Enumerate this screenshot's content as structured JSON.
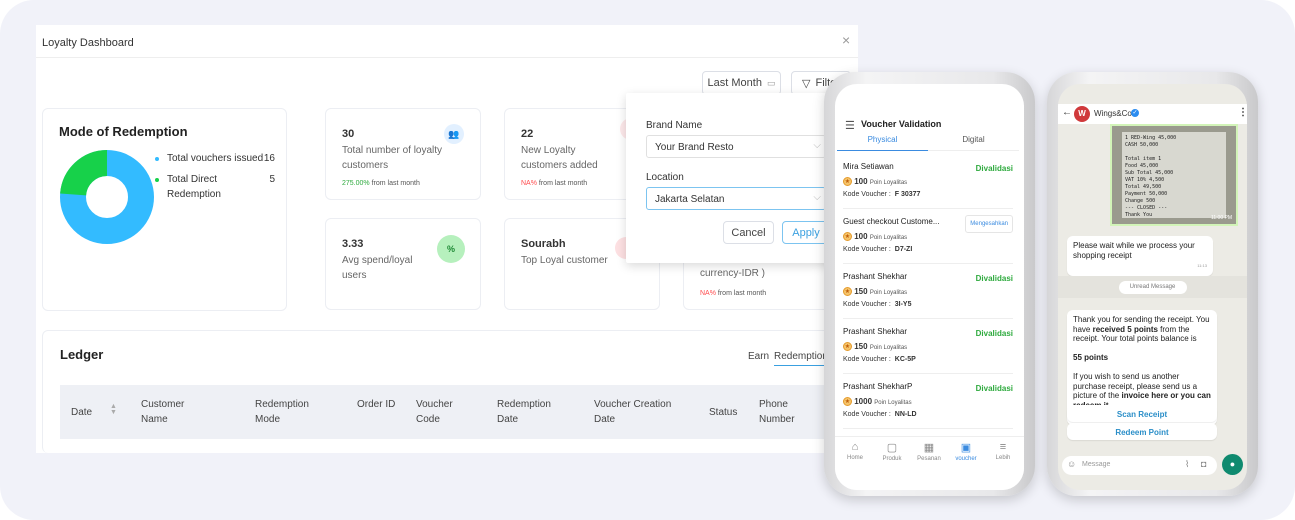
{
  "dashboard": {
    "title": "Loyalty Dashboard",
    "date_filter": "Last Month",
    "filter_label": "Filter",
    "mode": {
      "title": "Mode of Redemption",
      "legend": [
        {
          "label": "Total vouchers issued",
          "value": 16,
          "color": "#33bbff"
        },
        {
          "label": "Total Direct Redemption",
          "value": 5,
          "color": "#17d14a"
        }
      ]
    },
    "cards": [
      {
        "value": "30",
        "label": "Total number of loyalty customers",
        "change": "275.00%",
        "change_suffix": "from last month",
        "change_color": "#2eaa3e",
        "icon": "users-icon"
      },
      {
        "value": "22",
        "label": "New Loyalty customers added",
        "change": "NA%",
        "change_suffix": "from last month",
        "change_color": "#ff4d4f",
        "icon": "user-add-icon"
      },
      {
        "value": "3.33",
        "label": "Avg spend/loyal users",
        "icon": "percent-icon"
      },
      {
        "value": "Sourabh",
        "label": "Top Loyal customer",
        "icon": "gift-icon"
      },
      {
        "label": "currency-IDR )",
        "change": "NA%",
        "change_suffix": "from last month",
        "change_color": "#ff4d4f"
      }
    ],
    "filter_popup": {
      "brand_label": "Brand Name",
      "brand_value": "Your Brand Resto",
      "location_label": "Location",
      "location_value": "Jakarta Selatan",
      "cancel": "Cancel",
      "apply": "Apply"
    },
    "ledger": {
      "title": "Ledger",
      "tabs": [
        "Earn",
        "Redemption"
      ],
      "columns": [
        "Date",
        "Customer Name",
        "Redemption Mode",
        "Order ID",
        "Voucher Code",
        "Redemption Date",
        "Voucher Creation Date",
        "Status",
        "Phone Number"
      ]
    }
  },
  "voucher_app": {
    "title": "Voucher Validation",
    "tabs": [
      "Physical",
      "Digital"
    ],
    "points_label": "Poin Loyalitas",
    "code_label": "Kode Voucher :",
    "items": [
      {
        "name": "Mira Setiawan",
        "points": "100",
        "code": "F 30377",
        "status": "Divalidasi"
      },
      {
        "name": "Guest checkout  Custome...",
        "points": "100",
        "code": "D7-ZI",
        "action": "Mengesahkan"
      },
      {
        "name": "Prashant Shekhar",
        "points": "150",
        "code": "3I-Y5",
        "status": "Divalidasi"
      },
      {
        "name": "Prashant Shekhar",
        "points": "150",
        "code": "KC-5P",
        "status": "Divalidasi"
      },
      {
        "name": "Prashant ShekharP",
        "points": "1000",
        "code": "NN-LD",
        "status": "Divalidasi"
      },
      {
        "name": "Prashant ShekharP",
        "status": "Divalidasi"
      }
    ],
    "nav": [
      "Home",
      "Produk",
      "Pesanan",
      "voucher",
      "Lebih"
    ]
  },
  "chat_app": {
    "contact": "Wings&Co",
    "receipt_time": "11:00 PM",
    "msg1": "Please wait while we process your shopping receipt",
    "msg1_time": "11:13",
    "unread": "Unread Message",
    "msg2_a": "Thank you for sending the receipt. You have ",
    "msg2_b": "received 5 points",
    "msg2_c": " from the receipt. Your total points balance is",
    "msg2_points": "55  points",
    "msg2_d": "If you wish to send us another purchase receipt, please send us a picture of the ",
    "msg2_e": "invoice here or you can redeem it.",
    "msg2_time": "11:13",
    "btn1": "Scan Receipt",
    "btn2": "Redeem Point",
    "placeholder": "Message"
  }
}
